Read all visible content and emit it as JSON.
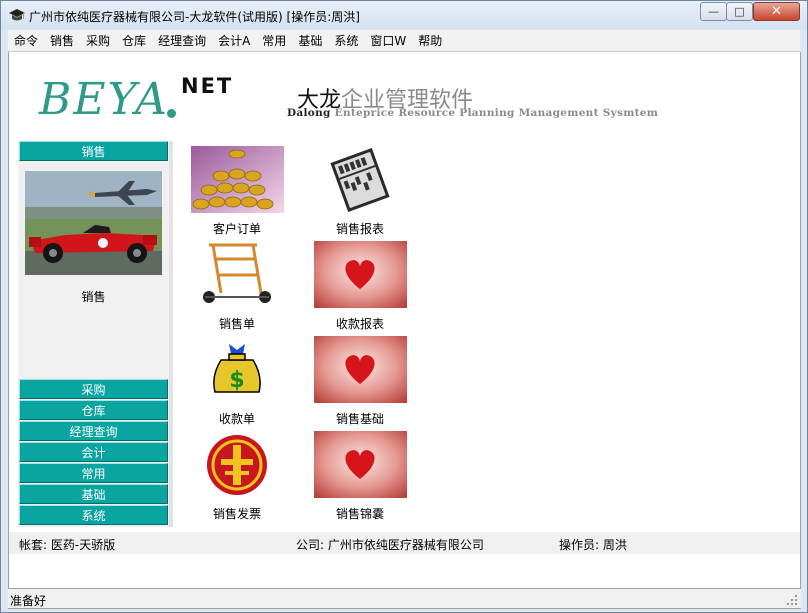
{
  "window": {
    "title": "广州市依纯医疗器械有限公司-大龙软件(试用版) [操作员:周洪]",
    "controls": {
      "minimize": "—",
      "maximize": "□",
      "close": "✕"
    }
  },
  "menubar": {
    "items": [
      "命令",
      "销售",
      "采购",
      "仓库",
      "经理查询",
      "会计A",
      "常用",
      "基础",
      "系统",
      "窗口W",
      "帮助"
    ]
  },
  "banner": {
    "logo_beya": "BEYA",
    "logo_net": "NET",
    "title_strong": "大龙",
    "title_rest": "企业管理软件",
    "subtitle_strong": "Dalong",
    "subtitle_rest": " Enteprice Resource Planning Management Sysmtem"
  },
  "leftnav": {
    "active": "销售",
    "active_panel_label": "销售",
    "bottom_items": [
      "采购",
      "仓库",
      "经理查询",
      "会计",
      "常用",
      "基础",
      "系统"
    ],
    "accent_color": "#0aa5a0"
  },
  "modules": [
    {
      "label": "客户订单",
      "icon": "gold-coins-icon"
    },
    {
      "label": "销售报表",
      "icon": "abacus-icon"
    },
    {
      "label": "销售单",
      "icon": "hand-truck-icon"
    },
    {
      "label": "收款报表",
      "icon": "heart-icon"
    },
    {
      "label": "收款单",
      "icon": "money-bag-icon"
    },
    {
      "label": "销售基础",
      "icon": "heart-icon"
    },
    {
      "label": "销售发票",
      "icon": "tax-emblem-icon"
    },
    {
      "label": "销售锦囊",
      "icon": "heart-icon"
    }
  ],
  "infobar": {
    "account_label": "帐套:",
    "account_value": "医药-天骄版",
    "company_label": "公司:",
    "company_value": "广州市依纯医疗器械有限公司",
    "operator_label": "操作员:",
    "operator_value": "周洪"
  },
  "statusbar": {
    "text": "准备好"
  }
}
